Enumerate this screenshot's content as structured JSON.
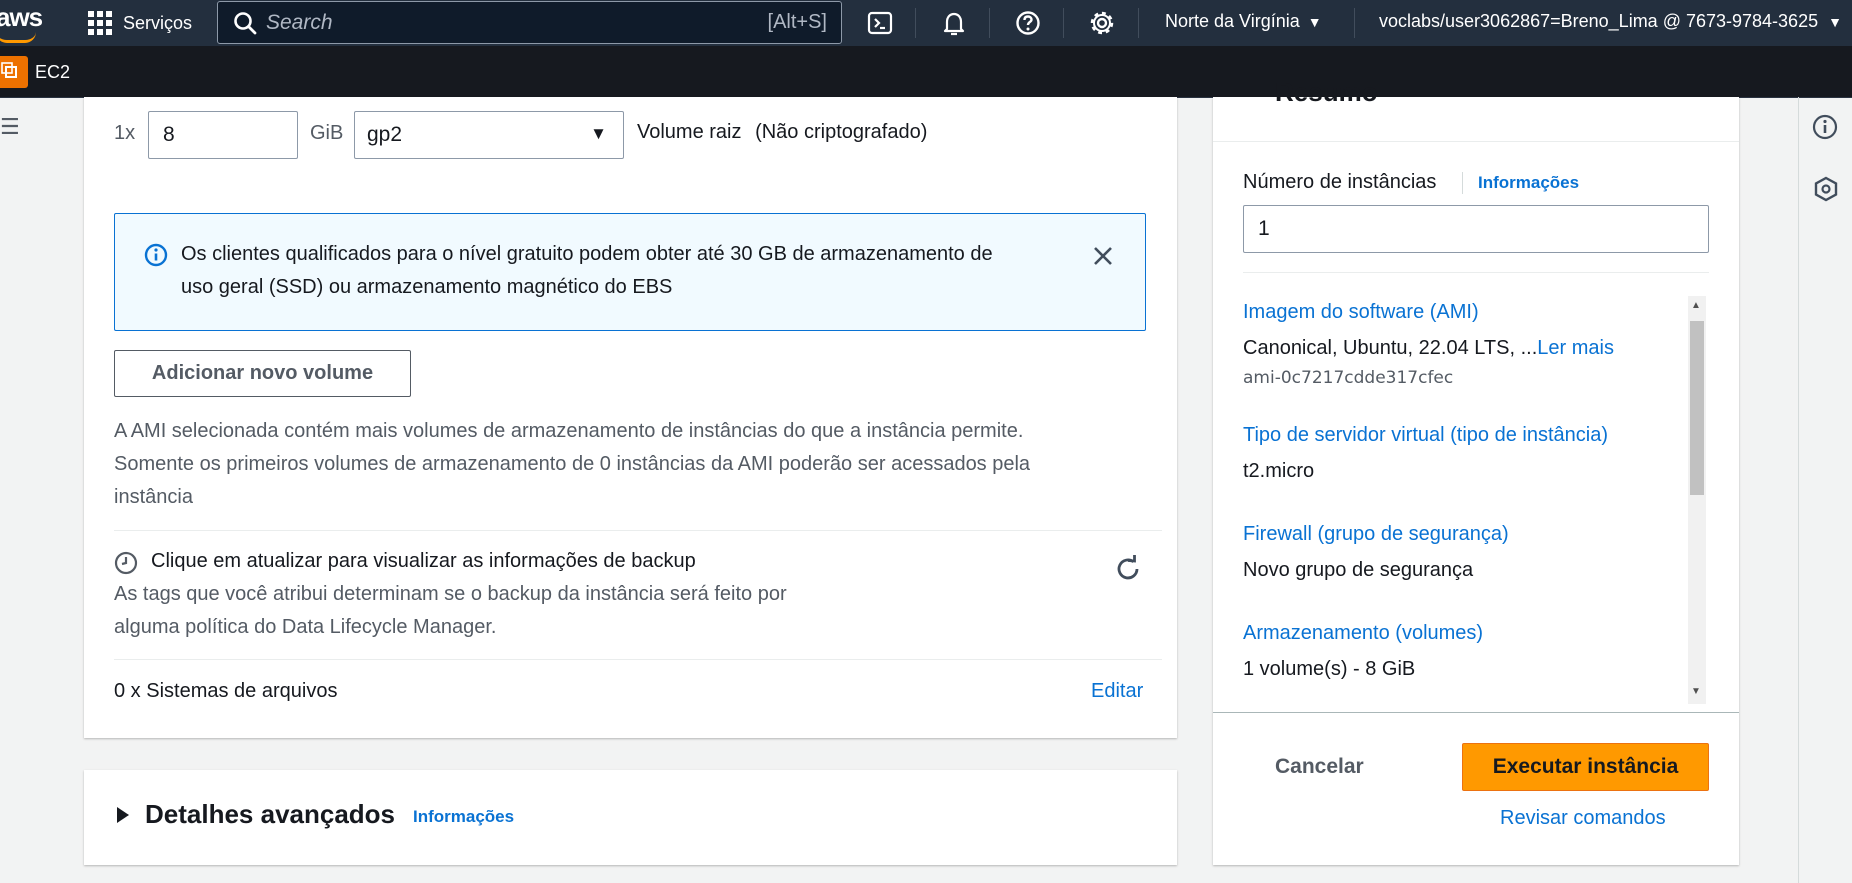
{
  "topbar": {
    "logo": "aws",
    "services_label": "Serviços",
    "search_placeholder": "Search",
    "search_shortcut": "[Alt+S]",
    "region": "Norte da Virgínia",
    "account": "voclabs/user3062867=Breno_Lima @ 7673-9784-3625",
    "icons": [
      "grid-icon",
      "search-icon",
      "cloudshell-icon",
      "bell-icon",
      "help-icon",
      "gear-icon"
    ]
  },
  "secbar": {
    "service": "EC2"
  },
  "storage": {
    "multiplier": "1x",
    "size_value": "8",
    "unit": "GiB",
    "volume_type": "gp2",
    "root_label": "Volume raiz",
    "encryption": "(Não criptografado)",
    "alert_line1": "Os clientes qualificados para o nível gratuito podem obter até 30 GB de armazenamento de",
    "alert_line2": "uso geral (SSD) ou armazenamento magnético do EBS",
    "add_volume": "Adicionar novo volume",
    "ami_note_line1": "A AMI selecionada contém mais volumes de armazenamento de instâncias do que a instância permite.",
    "ami_note_line2": "Somente os primeiros volumes de armazenamento de 0 instâncias da AMI poderão ser acessados pela",
    "ami_note_line3": "instância",
    "backup_title": "Clique em atualizar para visualizar as informações de backup",
    "backup_desc_line1": "As tags que você atribui determinam se o backup da instância será feito por",
    "backup_desc_line2": "alguma política do Data Lifecycle Manager.",
    "filesystems": "0 x Sistemas de arquivos",
    "edit": "Editar"
  },
  "advanced": {
    "title": "Detalhes avançados",
    "info": "Informações"
  },
  "summary": {
    "heading": "Resumo",
    "instances_label": "Número de instâncias",
    "instances_info": "Informações",
    "instances_value": "1",
    "ami_title": "Imagem do software (AMI)",
    "ami_value": "Canonical, Ubuntu, 22.04 LTS, ...",
    "ami_more": "Ler mais",
    "ami_id": "ami-0c7217cdde317cfec",
    "type_title": "Tipo de servidor virtual (tipo de instância)",
    "type_value": "t2.micro",
    "firewall_title": "Firewall (grupo de segurança)",
    "firewall_value": "Novo grupo de segurança",
    "storage_title": "Armazenamento (volumes)",
    "storage_value": "1 volume(s) - 8 GiB",
    "cancel": "Cancelar",
    "launch": "Executar instância",
    "review": "Revisar comandos"
  }
}
